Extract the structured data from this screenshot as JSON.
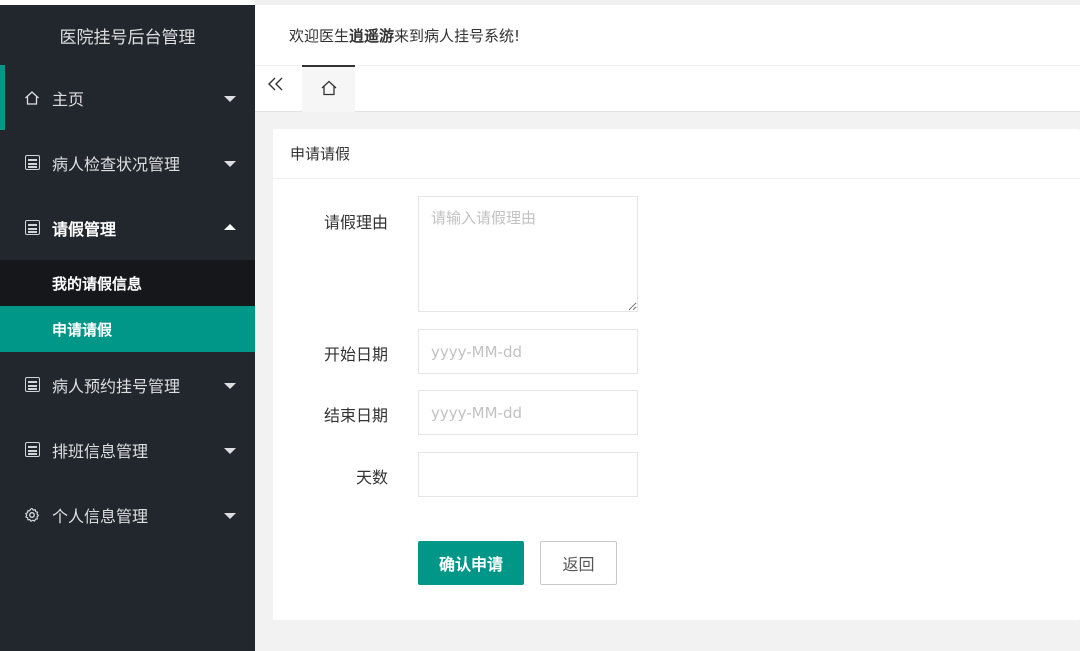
{
  "app": {
    "title": "医院挂号后台管理"
  },
  "header": {
    "welcome_prefix": "欢迎医生",
    "doctor_name": "逍遥游",
    "welcome_suffix": "来到病人挂号系统!"
  },
  "sidebar": {
    "items": [
      {
        "label": "主页",
        "icon": "home-icon"
      },
      {
        "label": "病人检查状况管理",
        "icon": "calendar-icon"
      },
      {
        "label": "请假管理",
        "icon": "calendar-icon",
        "expanded": true,
        "children": [
          {
            "label": "我的请假信息"
          },
          {
            "label": "申请请假",
            "selected": true
          }
        ]
      },
      {
        "label": "病人预约挂号管理",
        "icon": "calendar-icon"
      },
      {
        "label": "排班信息管理",
        "icon": "calendar-icon"
      },
      {
        "label": "个人信息管理",
        "icon": "gear-icon"
      }
    ]
  },
  "tabs": {
    "collapse_icon": "double-chevron-left-icon",
    "home_icon": "home-icon"
  },
  "form": {
    "title": "申请请假",
    "reason": {
      "label": "请假理由",
      "placeholder": "请输入请假理由"
    },
    "start_date": {
      "label": "开始日期",
      "placeholder": "yyyy-MM-dd"
    },
    "end_date": {
      "label": "结束日期",
      "placeholder": "yyyy-MM-dd"
    },
    "days": {
      "label": "天数",
      "placeholder": ""
    },
    "submit_label": "确认申请",
    "back_label": "返回"
  },
  "colors": {
    "accent": "#009688",
    "sidebar_bg": "#22262d"
  }
}
